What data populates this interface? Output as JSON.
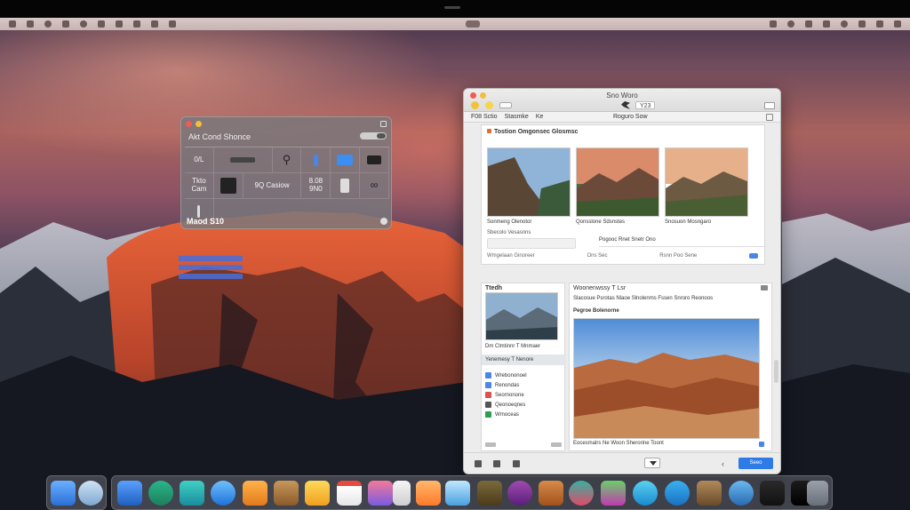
{
  "utility_window": {
    "title": "Akt Cond Shonce",
    "cells": [
      "0/L",
      "",
      "",
      "",
      "",
      "",
      "",
      "Tkto\nCam",
      "",
      "9Q Casiow",
      "8.08\n9N0",
      "",
      "",
      ""
    ],
    "footer": "Maod S10"
  },
  "main_window": {
    "title": "Sno Woro",
    "version_badge": "Y23",
    "tabs": [
      "F08 Sctio",
      "Stasmke",
      "Ke"
    ],
    "tab_center": "Roguro Sow",
    "top_panel": {
      "heading": "Tostion Omgonsec Glosmsc",
      "captions": [
        "Sonmeng Olenotor",
        "Qonsslone Sdsnstes",
        "Snosuon Mosngaro"
      ],
      "line1": "Sbecolo Vesasnns",
      "line2": "Pogooc Rnet Snetr Ono",
      "meta": [
        "Wmgelaan Ginoreer",
        "Ons Sec",
        "Rsnn Poo Sene"
      ]
    },
    "sidebar": {
      "heading": "Ttedh",
      "image_caption": "Dm Clmtinnr T Mnmaer",
      "selected": "Yenemesy T Nenore",
      "items": [
        {
          "label": "Wrebononoel",
          "icon_color": "#4a86e8"
        },
        {
          "label": "Renondas",
          "icon_color": "#4a86e8"
        },
        {
          "label": "Seornonone",
          "icon_color": "#d9534f"
        },
        {
          "label": "Qeonoeqnes",
          "icon_color": "#555555"
        },
        {
          "label": "Wrnoceas",
          "icon_color": "#2e9e4f"
        }
      ]
    },
    "content": {
      "heading": "Woonenwssy T Lsr",
      "line": "Slacosue Psrotas Nlaoe Slnolenms Fssen Snroro Reonoos",
      "subheading": "Pegroe Bolenorne",
      "caption": "Eocesmalrs Ne Woon Sherorine Toont"
    },
    "primary_button": "Seeo"
  },
  "colors": {
    "accent": "#2f7be5",
    "traffic_red": "#f25b54",
    "traffic_yellow": "#f5bd3b",
    "traffic_green": "#4fc743"
  },
  "dock": {
    "left_items": [
      "finder-icon",
      "globe-icon"
    ],
    "items": [
      "photos-icon",
      "maps-icon",
      "mail-icon",
      "safari-icon",
      "notes-icon",
      "contacts-icon",
      "pages-icon",
      "calendar-icon",
      "photos-booth-icon",
      "files-icon",
      "music-icon",
      "app-store-icon",
      "books-icon",
      "podcasts-icon",
      "tv-icon",
      "terminal-icon",
      "game-center-icon",
      "weather-icon",
      "telegram-icon",
      "preview-icon",
      "chrome-icon",
      "settings-icon",
      "trash-icon"
    ]
  }
}
